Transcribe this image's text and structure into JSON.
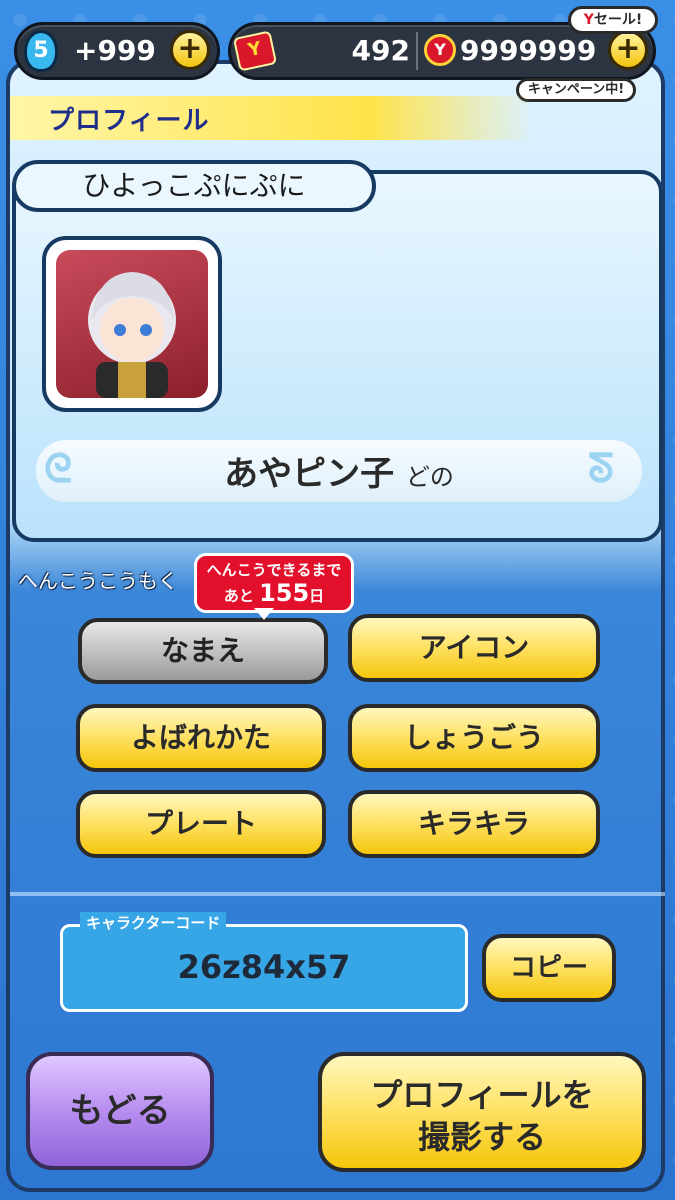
{
  "top_bar": {
    "level": "5",
    "stamina_count": "+999",
    "ticket_count": "492",
    "coin_count": "9999999",
    "sale_label": "セール!",
    "campaign_label": "キャンペーン中!"
  },
  "header": {
    "title": "プロフィール"
  },
  "profile": {
    "player_name": "ひよっこぷにぷに",
    "call_name": "あやピン子",
    "call_suffix": "どの"
  },
  "change_section": {
    "label": "へんこうこうもく",
    "countdown_line1": "へんこうできるまで",
    "countdown_prefix": "あと",
    "countdown_value": "155",
    "countdown_unit": "日",
    "buttons": [
      "なまえ",
      "アイコン",
      "よばれかた",
      "しょうごう",
      "プレート",
      "キラキラ"
    ]
  },
  "character_code": {
    "label": "キャラクターコード",
    "value": "26z84x57",
    "copy_label": "コピー"
  },
  "footer": {
    "back_label": "もどる",
    "photo_line1": "プロフィールを",
    "photo_line2": "撮影する"
  },
  "colors": {
    "accent_yellow": "#f5c60a",
    "disabled_gray": "#9a9a9a",
    "back_purple": "#9064d8",
    "alert_red": "#e3102b",
    "outline": "#173a63"
  }
}
